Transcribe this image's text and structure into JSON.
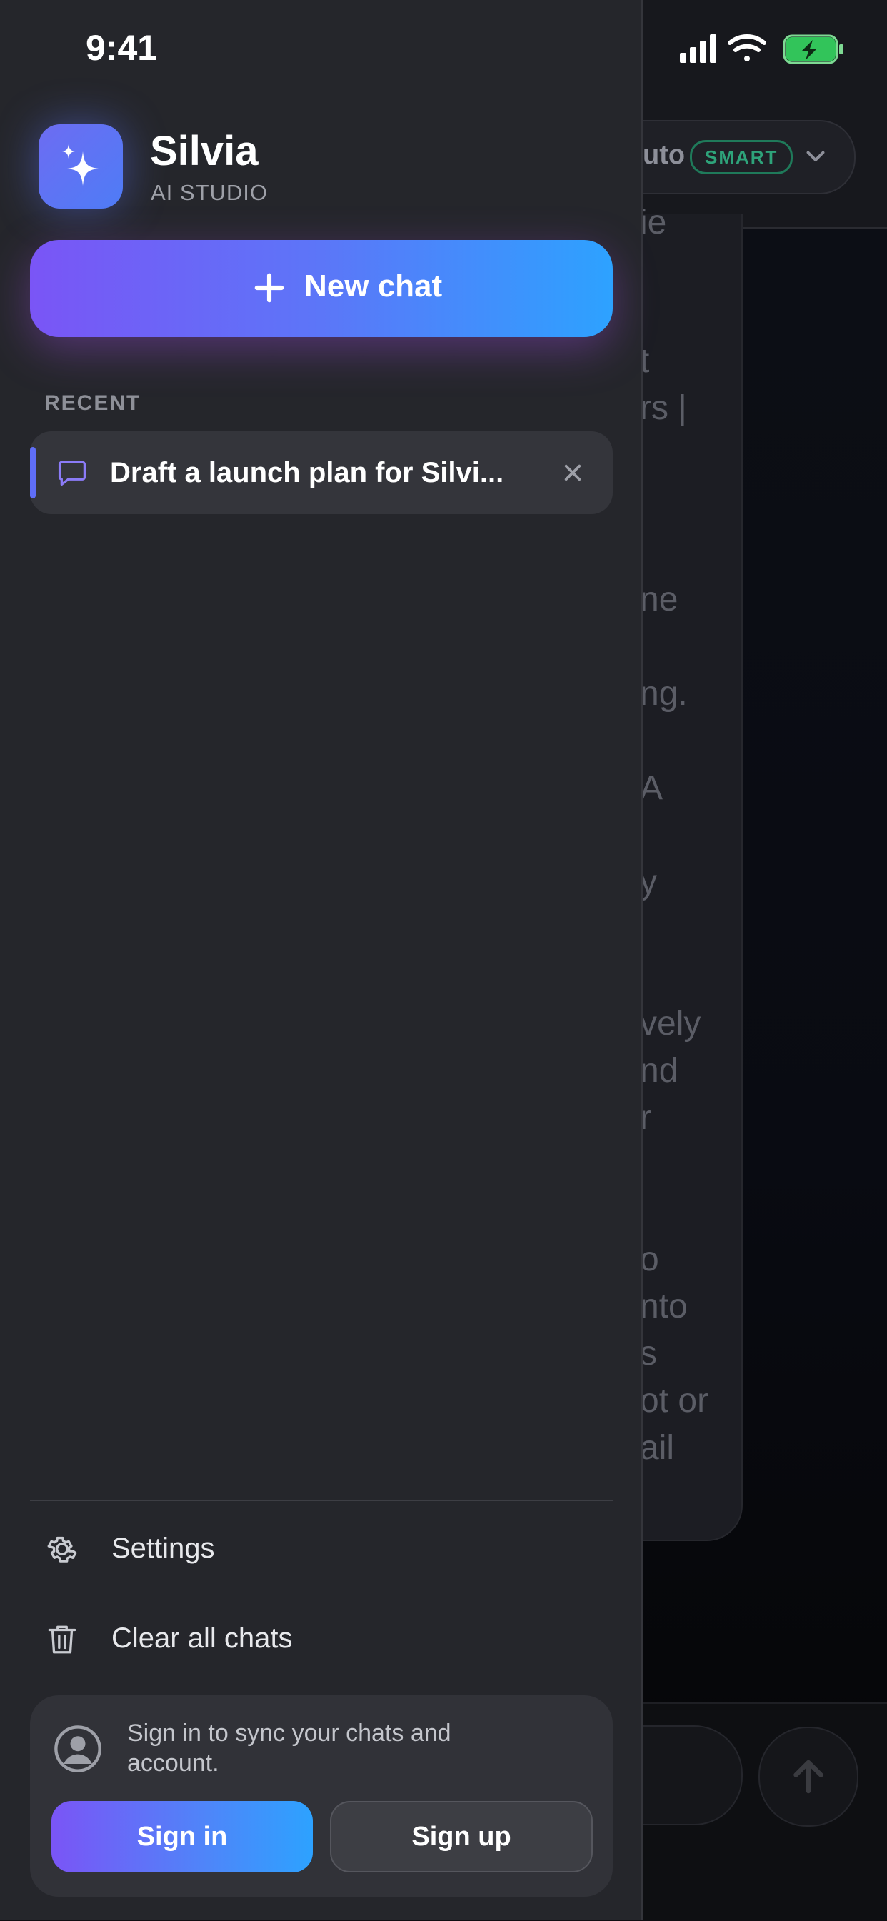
{
  "status_bar": {
    "time": "9:41"
  },
  "background": {
    "model_name": "uto",
    "model_badge": "SMART",
    "message_fragments": [
      "ie",
      "t",
      "rs |",
      "ne",
      "ng.",
      "A",
      "y",
      "vely",
      "nd",
      "r",
      "o",
      "nto",
      "s",
      "ot or",
      "ail"
    ]
  },
  "drawer": {
    "app_name": "Silvia",
    "app_subtitle": "AI STUDIO",
    "new_chat_label": "New chat",
    "recent_label": "RECENT",
    "recent_chats": [
      {
        "title": "Draft a launch plan for Silvi...",
        "active": true
      }
    ],
    "menu": {
      "settings_label": "Settings",
      "clear_label": "Clear all chats"
    },
    "account": {
      "message": "Sign in to sync your chats and account.",
      "sign_in_label": "Sign in",
      "sign_up_label": "Sign up"
    }
  },
  "colors": {
    "accent_start": "#7a55f6",
    "accent_end": "#2da2ff",
    "drawer_bg": "#25262b",
    "smart_badge": "#2ea37a"
  }
}
